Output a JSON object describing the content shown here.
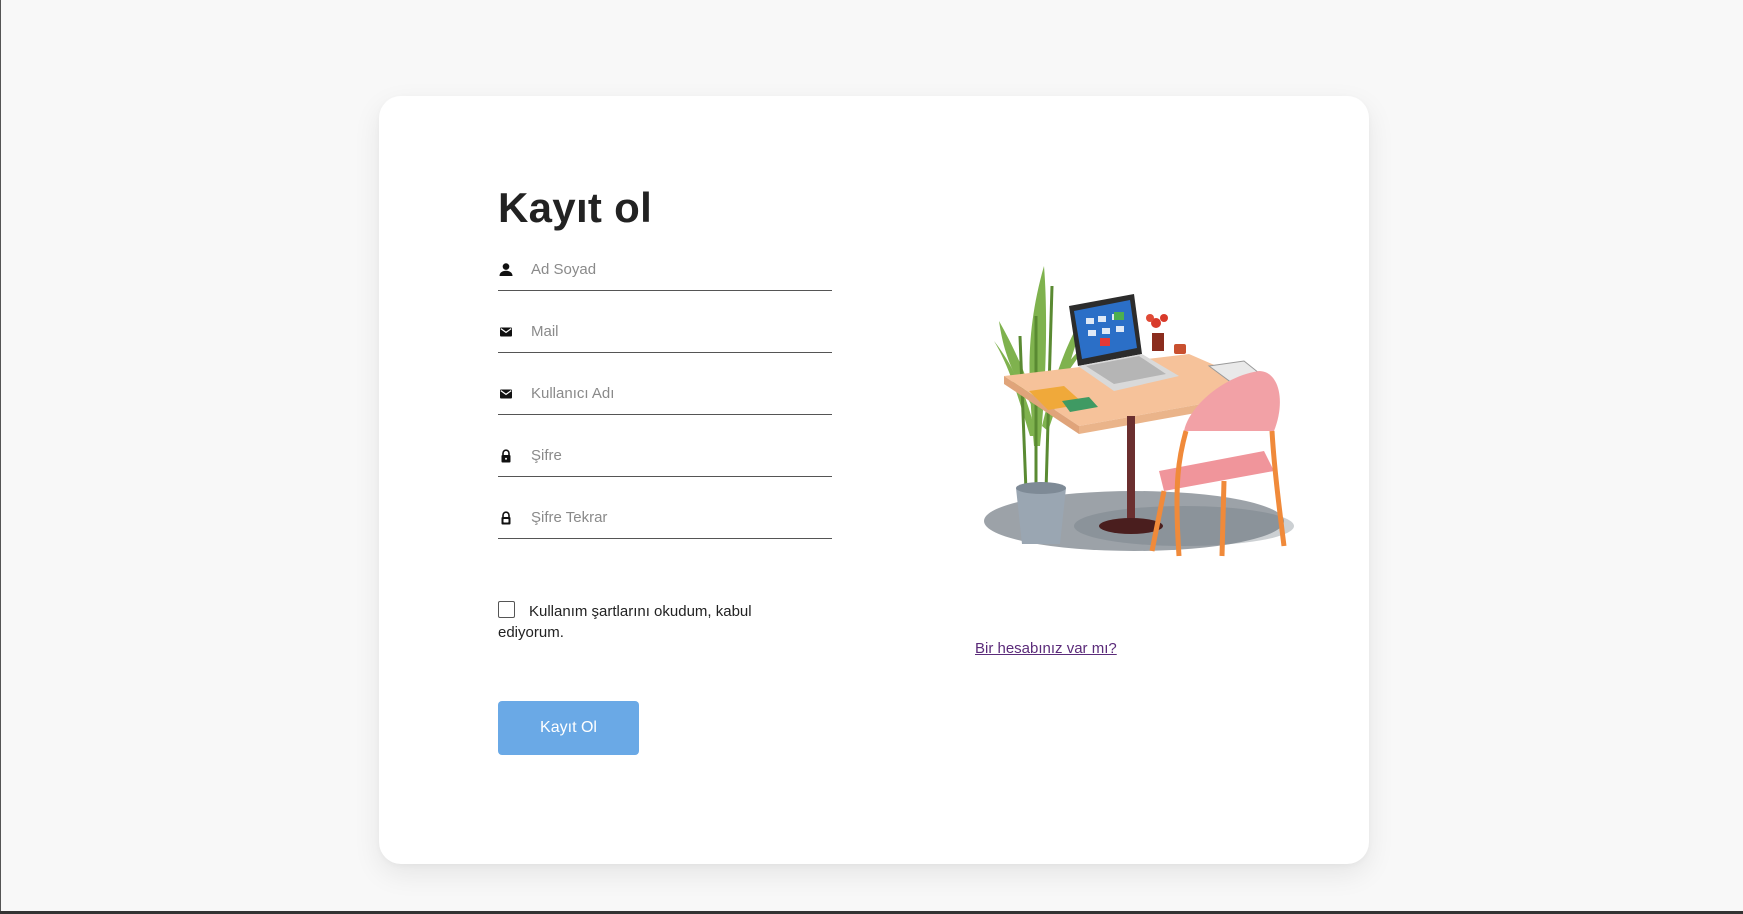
{
  "form": {
    "title": "Kayıt ol",
    "fields": [
      {
        "placeholder": "Ad Soyad",
        "icon": "person-icon"
      },
      {
        "placeholder": "Mail",
        "icon": "envelope-icon"
      },
      {
        "placeholder": "Kullanıcı Adı",
        "icon": "envelope-icon"
      },
      {
        "placeholder": "Şifre",
        "icon": "lock-icon"
      },
      {
        "placeholder": "Şifre Tekrar",
        "icon": "lock-outline-icon"
      }
    ],
    "terms_label": "Kullanım şartlarını okudum, kabul ediyorum.",
    "submit_label": "Kayıt Ol"
  },
  "side": {
    "illustration": "desk-with-laptop-chair-and-plant",
    "login_link": "Bir hesabınız var mı?"
  },
  "colors": {
    "background": "#f8f8f8",
    "card": "#ffffff",
    "button": "#6aa9e6",
    "link": "#5b2b7a"
  }
}
